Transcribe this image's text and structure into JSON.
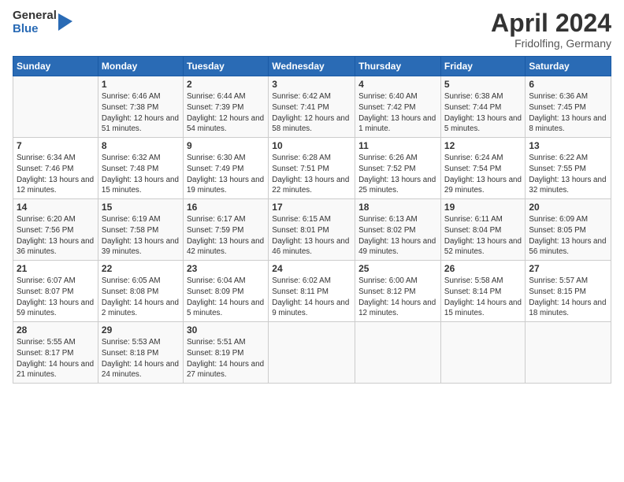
{
  "logo": {
    "general": "General",
    "blue": "Blue"
  },
  "title": {
    "month": "April 2024",
    "location": "Fridolfing, Germany"
  },
  "weekdays": [
    "Sunday",
    "Monday",
    "Tuesday",
    "Wednesday",
    "Thursday",
    "Friday",
    "Saturday"
  ],
  "weeks": [
    [
      {
        "day": "",
        "sunrise": "",
        "sunset": "",
        "daylight": ""
      },
      {
        "day": "1",
        "sunrise": "Sunrise: 6:46 AM",
        "sunset": "Sunset: 7:38 PM",
        "daylight": "Daylight: 12 hours and 51 minutes."
      },
      {
        "day": "2",
        "sunrise": "Sunrise: 6:44 AM",
        "sunset": "Sunset: 7:39 PM",
        "daylight": "Daylight: 12 hours and 54 minutes."
      },
      {
        "day": "3",
        "sunrise": "Sunrise: 6:42 AM",
        "sunset": "Sunset: 7:41 PM",
        "daylight": "Daylight: 12 hours and 58 minutes."
      },
      {
        "day": "4",
        "sunrise": "Sunrise: 6:40 AM",
        "sunset": "Sunset: 7:42 PM",
        "daylight": "Daylight: 13 hours and 1 minute."
      },
      {
        "day": "5",
        "sunrise": "Sunrise: 6:38 AM",
        "sunset": "Sunset: 7:44 PM",
        "daylight": "Daylight: 13 hours and 5 minutes."
      },
      {
        "day": "6",
        "sunrise": "Sunrise: 6:36 AM",
        "sunset": "Sunset: 7:45 PM",
        "daylight": "Daylight: 13 hours and 8 minutes."
      }
    ],
    [
      {
        "day": "7",
        "sunrise": "Sunrise: 6:34 AM",
        "sunset": "Sunset: 7:46 PM",
        "daylight": "Daylight: 13 hours and 12 minutes."
      },
      {
        "day": "8",
        "sunrise": "Sunrise: 6:32 AM",
        "sunset": "Sunset: 7:48 PM",
        "daylight": "Daylight: 13 hours and 15 minutes."
      },
      {
        "day": "9",
        "sunrise": "Sunrise: 6:30 AM",
        "sunset": "Sunset: 7:49 PM",
        "daylight": "Daylight: 13 hours and 19 minutes."
      },
      {
        "day": "10",
        "sunrise": "Sunrise: 6:28 AM",
        "sunset": "Sunset: 7:51 PM",
        "daylight": "Daylight: 13 hours and 22 minutes."
      },
      {
        "day": "11",
        "sunrise": "Sunrise: 6:26 AM",
        "sunset": "Sunset: 7:52 PM",
        "daylight": "Daylight: 13 hours and 25 minutes."
      },
      {
        "day": "12",
        "sunrise": "Sunrise: 6:24 AM",
        "sunset": "Sunset: 7:54 PM",
        "daylight": "Daylight: 13 hours and 29 minutes."
      },
      {
        "day": "13",
        "sunrise": "Sunrise: 6:22 AM",
        "sunset": "Sunset: 7:55 PM",
        "daylight": "Daylight: 13 hours and 32 minutes."
      }
    ],
    [
      {
        "day": "14",
        "sunrise": "Sunrise: 6:20 AM",
        "sunset": "Sunset: 7:56 PM",
        "daylight": "Daylight: 13 hours and 36 minutes."
      },
      {
        "day": "15",
        "sunrise": "Sunrise: 6:19 AM",
        "sunset": "Sunset: 7:58 PM",
        "daylight": "Daylight: 13 hours and 39 minutes."
      },
      {
        "day": "16",
        "sunrise": "Sunrise: 6:17 AM",
        "sunset": "Sunset: 7:59 PM",
        "daylight": "Daylight: 13 hours and 42 minutes."
      },
      {
        "day": "17",
        "sunrise": "Sunrise: 6:15 AM",
        "sunset": "Sunset: 8:01 PM",
        "daylight": "Daylight: 13 hours and 46 minutes."
      },
      {
        "day": "18",
        "sunrise": "Sunrise: 6:13 AM",
        "sunset": "Sunset: 8:02 PM",
        "daylight": "Daylight: 13 hours and 49 minutes."
      },
      {
        "day": "19",
        "sunrise": "Sunrise: 6:11 AM",
        "sunset": "Sunset: 8:04 PM",
        "daylight": "Daylight: 13 hours and 52 minutes."
      },
      {
        "day": "20",
        "sunrise": "Sunrise: 6:09 AM",
        "sunset": "Sunset: 8:05 PM",
        "daylight": "Daylight: 13 hours and 56 minutes."
      }
    ],
    [
      {
        "day": "21",
        "sunrise": "Sunrise: 6:07 AM",
        "sunset": "Sunset: 8:07 PM",
        "daylight": "Daylight: 13 hours and 59 minutes."
      },
      {
        "day": "22",
        "sunrise": "Sunrise: 6:05 AM",
        "sunset": "Sunset: 8:08 PM",
        "daylight": "Daylight: 14 hours and 2 minutes."
      },
      {
        "day": "23",
        "sunrise": "Sunrise: 6:04 AM",
        "sunset": "Sunset: 8:09 PM",
        "daylight": "Daylight: 14 hours and 5 minutes."
      },
      {
        "day": "24",
        "sunrise": "Sunrise: 6:02 AM",
        "sunset": "Sunset: 8:11 PM",
        "daylight": "Daylight: 14 hours and 9 minutes."
      },
      {
        "day": "25",
        "sunrise": "Sunrise: 6:00 AM",
        "sunset": "Sunset: 8:12 PM",
        "daylight": "Daylight: 14 hours and 12 minutes."
      },
      {
        "day": "26",
        "sunrise": "Sunrise: 5:58 AM",
        "sunset": "Sunset: 8:14 PM",
        "daylight": "Daylight: 14 hours and 15 minutes."
      },
      {
        "day": "27",
        "sunrise": "Sunrise: 5:57 AM",
        "sunset": "Sunset: 8:15 PM",
        "daylight": "Daylight: 14 hours and 18 minutes."
      }
    ],
    [
      {
        "day": "28",
        "sunrise": "Sunrise: 5:55 AM",
        "sunset": "Sunset: 8:17 PM",
        "daylight": "Daylight: 14 hours and 21 minutes."
      },
      {
        "day": "29",
        "sunrise": "Sunrise: 5:53 AM",
        "sunset": "Sunset: 8:18 PM",
        "daylight": "Daylight: 14 hours and 24 minutes."
      },
      {
        "day": "30",
        "sunrise": "Sunrise: 5:51 AM",
        "sunset": "Sunset: 8:19 PM",
        "daylight": "Daylight: 14 hours and 27 minutes."
      },
      {
        "day": "",
        "sunrise": "",
        "sunset": "",
        "daylight": ""
      },
      {
        "day": "",
        "sunrise": "",
        "sunset": "",
        "daylight": ""
      },
      {
        "day": "",
        "sunrise": "",
        "sunset": "",
        "daylight": ""
      },
      {
        "day": "",
        "sunrise": "",
        "sunset": "",
        "daylight": ""
      }
    ]
  ]
}
